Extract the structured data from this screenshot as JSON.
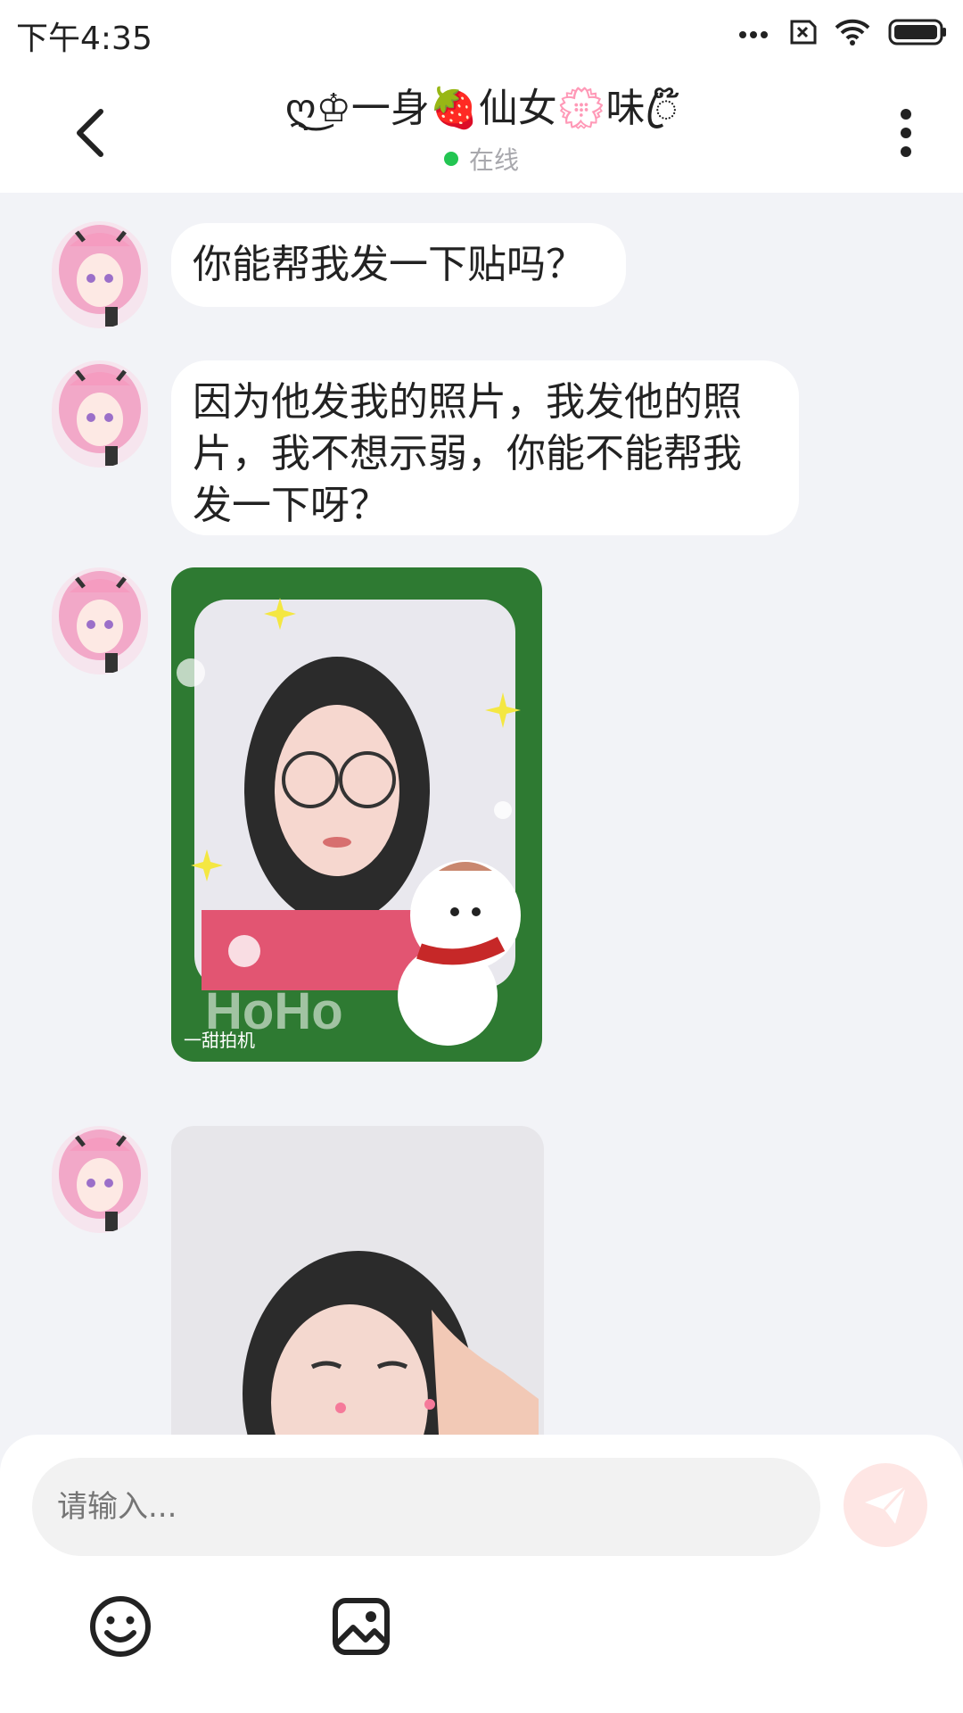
{
  "status_bar": {
    "time": "下午4:35",
    "icons": [
      "more-dots-icon",
      "sim-error-icon",
      "wifi-icon",
      "battery-icon"
    ]
  },
  "header": {
    "title": "ღ͜♔一身🍓仙女💮味ꦿ໊",
    "status": "在线",
    "online_color": "#23c552"
  },
  "messages": [
    {
      "type": "text",
      "text": "你能帮我发一下贴吗？"
    },
    {
      "type": "text",
      "text": "因为他发我的照片，我发他的照片，我不想示弱，你能不能帮我发一下呀？"
    },
    {
      "type": "image",
      "caption": "HoHo",
      "watermark": "一甜拍机"
    },
    {
      "type": "image"
    }
  ],
  "composer": {
    "placeholder": "请输入...",
    "send_color": "#fee6e4",
    "tools": [
      "emoji-icon",
      "image-icon"
    ]
  }
}
